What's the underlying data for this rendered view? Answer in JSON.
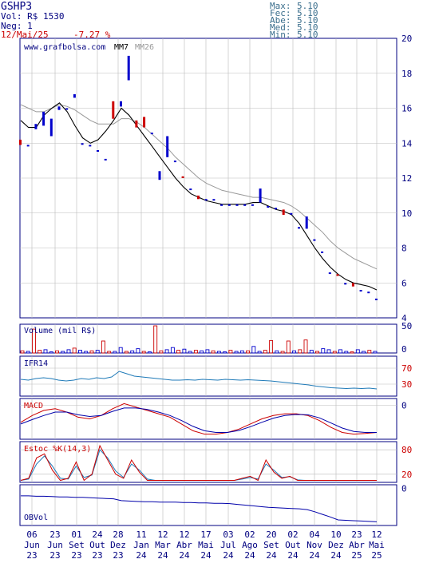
{
  "header": {
    "ticker": "GSHP3",
    "volume_line": "Vol: R$ 1530",
    "trades_line": "Neg: 1",
    "date": "12/Mai/25",
    "change": "-7.27 %",
    "stats": [
      {
        "label": "Max:",
        "value": "5.10"
      },
      {
        "label": "Fec:",
        "value": "5.10"
      },
      {
        "label": "Abe:",
        "value": "5.10"
      },
      {
        "label": "Med:",
        "value": "5.10"
      },
      {
        "label": "Min:",
        "value": "5.10"
      }
    ]
  },
  "colors": {
    "up": "#0000cc",
    "down": "#cc0000",
    "mm7": "#000000",
    "mm26": "#999999",
    "grid": "#bbbbbb",
    "axis": "#000080",
    "ifr": "#1f7ab8",
    "obv": "#0000aa"
  },
  "chart_data": [
    {
      "type": "candlestick",
      "source_label": "www.grafbolsa.com",
      "legend": [
        "MM7",
        "MM26"
      ],
      "ylim": [
        4,
        20
      ],
      "yticks": [
        "4",
        "6",
        "8",
        "10",
        "12",
        "14",
        "16",
        "18",
        "20"
      ],
      "x_ticks": [
        {
          "day": "06",
          "month": "Jun",
          "year": "23"
        },
        {
          "day": "23",
          "month": "Jun",
          "year": "23"
        },
        {
          "day": "01",
          "month": "Set",
          "year": "23"
        },
        {
          "day": "24",
          "month": "Out",
          "year": "23"
        },
        {
          "day": "28",
          "month": "Dez",
          "year": "23"
        },
        {
          "day": "11",
          "month": "Jan",
          "year": "24"
        },
        {
          "day": "12",
          "month": "Mar",
          "year": "24"
        },
        {
          "day": "12",
          "month": "Abr",
          "year": "24"
        },
        {
          "day": "17",
          "month": "Mai",
          "year": "24"
        },
        {
          "day": "03",
          "month": "Jul",
          "year": "24"
        },
        {
          "day": "02",
          "month": "Ago",
          "year": "24"
        },
        {
          "day": "20",
          "month": "Set",
          "year": "24"
        },
        {
          "day": "02",
          "month": "Out",
          "year": "24"
        },
        {
          "day": "04",
          "month": "Nov",
          "year": "24"
        },
        {
          "day": "10",
          "month": "Dez",
          "year": "24"
        },
        {
          "day": "23",
          "month": "Abr",
          "year": "25"
        },
        {
          "day": "12",
          "month": "Mai",
          "year": "25"
        }
      ],
      "candles": [
        {
          "o": 14.2,
          "c": 13.9
        },
        {
          "o": 13.9,
          "c": 13.9
        },
        {
          "o": 14.8,
          "c": 15.1
        },
        {
          "o": 15.0,
          "c": 15.8
        },
        {
          "o": 14.4,
          "c": 15.4
        },
        {
          "o": 15.9,
          "c": 16.1
        },
        {
          "o": 16.0,
          "c": 16.0
        },
        {
          "o": 16.6,
          "c": 16.8
        },
        {
          "o": 14.0,
          "c": 14.0
        },
        {
          "o": 13.9,
          "c": 13.9
        },
        {
          "o": 13.6,
          "c": 13.6
        },
        {
          "o": 13.1,
          "c": 13.1
        },
        {
          "o": 16.4,
          "c": 15.4
        },
        {
          "o": 16.1,
          "c": 16.4
        },
        {
          "o": 17.6,
          "c": 19.0
        },
        {
          "o": 15.3,
          "c": 14.9
        },
        {
          "o": 15.5,
          "c": 14.9
        },
        {
          "o": 14.6,
          "c": 14.6
        },
        {
          "o": 11.9,
          "c": 12.4
        },
        {
          "o": 13.2,
          "c": 14.4
        },
        {
          "o": 13.0,
          "c": 13.0
        },
        {
          "o": 12.1,
          "c": 12.0
        },
        {
          "o": 11.4,
          "c": 11.4
        },
        {
          "o": 11.0,
          "c": 10.8
        },
        {
          "o": 10.8,
          "c": 10.8
        },
        {
          "o": 10.8,
          "c": 10.8
        },
        {
          "o": 10.5,
          "c": 10.5
        },
        {
          "o": 10.5,
          "c": 10.5
        },
        {
          "o": 10.5,
          "c": 10.5
        },
        {
          "o": 10.5,
          "c": 10.5
        },
        {
          "o": 10.5,
          "c": 10.5
        },
        {
          "o": 10.6,
          "c": 11.4
        },
        {
          "o": 10.4,
          "c": 10.4
        },
        {
          "o": 10.3,
          "c": 10.3
        },
        {
          "o": 10.2,
          "c": 9.9
        },
        {
          "o": 10.0,
          "c": 10.0
        },
        {
          "o": 9.2,
          "c": 9.2
        },
        {
          "o": 9.1,
          "c": 9.8
        },
        {
          "o": 8.5,
          "c": 8.5
        },
        {
          "o": 7.8,
          "c": 7.8
        },
        {
          "o": 6.6,
          "c": 6.6
        },
        {
          "o": 6.5,
          "c": 6.4
        },
        {
          "o": 6.0,
          "c": 6.0
        },
        {
          "o": 6.0,
          "c": 5.8
        },
        {
          "o": 5.6,
          "c": 5.6
        },
        {
          "o": 5.5,
          "c": 5.5
        },
        {
          "o": 5.1,
          "c": 5.1
        }
      ],
      "mm7": [
        15.3,
        14.9,
        14.9,
        15.6,
        16.0,
        16.3,
        15.8,
        15.0,
        14.3,
        14.0,
        14.2,
        14.7,
        15.3,
        16.0,
        15.6,
        15.0,
        14.4,
        13.8,
        13.2,
        12.6,
        12.0,
        11.5,
        11.1,
        10.9,
        10.7,
        10.6,
        10.5,
        10.5,
        10.5,
        10.5,
        10.6,
        10.6,
        10.4,
        10.2,
        10.1,
        9.9,
        9.4,
        8.7,
        8.0,
        7.4,
        6.9,
        6.5,
        6.2,
        6.0,
        5.9,
        5.8,
        5.6
      ],
      "mm26": [
        16.2,
        16.0,
        15.8,
        15.8,
        16.0,
        16.2,
        16.1,
        15.9,
        15.6,
        15.3,
        15.1,
        15.1,
        15.1,
        15.4,
        15.4,
        15.2,
        14.9,
        14.5,
        14.1,
        13.7,
        13.2,
        12.8,
        12.4,
        12.0,
        11.7,
        11.5,
        11.3,
        11.2,
        11.1,
        11.0,
        10.9,
        10.9,
        10.8,
        10.7,
        10.6,
        10.4,
        10.1,
        9.7,
        9.3,
        8.9,
        8.4,
        8.0,
        7.7,
        7.4,
        7.2,
        7.0,
        6.8
      ]
    },
    {
      "type": "bar",
      "title": "Volume (mil R$)",
      "yticks": [
        "0",
        "50"
      ],
      "ylim": [
        0,
        50
      ],
      "values": [
        4,
        3,
        44,
        5,
        6,
        2,
        4,
        3,
        6,
        9,
        5,
        3,
        4,
        5,
        22,
        3,
        3,
        10,
        3,
        4,
        8,
        3,
        2,
        50,
        4,
        6,
        10,
        5,
        7,
        3,
        5,
        4,
        6,
        4,
        3,
        2,
        5,
        3,
        4,
        4,
        12,
        3,
        5,
        23,
        4,
        3,
        22,
        4,
        6,
        24,
        5,
        3,
        8,
        6,
        3,
        6,
        3,
        2,
        6,
        3,
        5,
        3
      ]
    },
    {
      "type": "line",
      "title": "IFR14",
      "yticks": [
        "30",
        "70"
      ],
      "ylim": [
        0,
        100
      ],
      "values": [
        42,
        40,
        44,
        46,
        44,
        40,
        38,
        40,
        44,
        42,
        46,
        44,
        48,
        62,
        56,
        50,
        48,
        46,
        44,
        42,
        40,
        40,
        41,
        40,
        42,
        41,
        40,
        42,
        41,
        40,
        41,
        40,
        39,
        38,
        36,
        34,
        32,
        30,
        28,
        25,
        23,
        21,
        20,
        19,
        20,
        19,
        20,
        18
      ]
    },
    {
      "type": "line",
      "title": "MACD",
      "yticks": [
        "0"
      ],
      "ylim": [
        -1.0,
        0.2
      ],
      "series": [
        {
          "values": [
            -0.5,
            -0.3,
            -0.15,
            -0.1,
            -0.2,
            -0.35,
            -0.4,
            -0.3,
            -0.1,
            0.05,
            -0.05,
            -0.15,
            -0.25,
            -0.35,
            -0.55,
            -0.75,
            -0.85,
            -0.85,
            -0.8,
            -0.7,
            -0.55,
            -0.4,
            -0.3,
            -0.25,
            -0.25,
            -0.3,
            -0.45,
            -0.65,
            -0.8,
            -0.85,
            -0.83,
            -0.8
          ]
        },
        {
          "values": [
            -0.55,
            -0.42,
            -0.3,
            -0.2,
            -0.2,
            -0.28,
            -0.33,
            -0.3,
            -0.18,
            -0.08,
            -0.08,
            -0.12,
            -0.2,
            -0.3,
            -0.45,
            -0.62,
            -0.75,
            -0.8,
            -0.8,
            -0.74,
            -0.63,
            -0.5,
            -0.38,
            -0.3,
            -0.27,
            -0.28,
            -0.37,
            -0.52,
            -0.67,
            -0.77,
            -0.8,
            -0.8
          ]
        }
      ]
    },
    {
      "type": "line",
      "title": "Estoc %K(14,3)",
      "yticks": [
        "20",
        "80"
      ],
      "ylim": [
        0,
        100
      ],
      "series": [
        {
          "values": [
            5,
            10,
            60,
            70,
            30,
            5,
            10,
            50,
            5,
            20,
            90,
            55,
            20,
            10,
            55,
            25,
            5,
            5,
            5,
            5,
            5,
            5,
            5,
            5,
            5,
            5,
            5,
            5,
            10,
            15,
            5,
            55,
            25,
            10,
            15,
            5,
            5,
            5,
            5,
            5,
            5,
            5,
            5,
            5,
            5,
            5
          ]
        },
        {
          "values": [
            5,
            8,
            45,
            65,
            40,
            10,
            8,
            40,
            12,
            18,
            80,
            60,
            28,
            12,
            45,
            30,
            8,
            5,
            5,
            5,
            5,
            5,
            5,
            5,
            5,
            5,
            5,
            5,
            8,
            12,
            8,
            45,
            30,
            12,
            14,
            6,
            5,
            5,
            5,
            5,
            5,
            5,
            5,
            5,
            5,
            5
          ]
        }
      ]
    },
    {
      "type": "line",
      "title": "OBVol",
      "yticks": [
        "0"
      ],
      "ylim": [
        -100,
        10
      ],
      "values": [
        -20,
        -20,
        -21,
        -21,
        -22,
        -23,
        -23,
        -24,
        -24,
        -25,
        -26,
        -27,
        -28,
        -33,
        -34,
        -35,
        -36,
        -36,
        -37,
        -37,
        -37,
        -38,
        -38,
        -39,
        -39,
        -40,
        -40,
        -41,
        -43,
        -45,
        -47,
        -49,
        -51,
        -52,
        -53,
        -54,
        -55,
        -57,
        -63,
        -70,
        -77,
        -85,
        -86,
        -87,
        -88,
        -89,
        -90
      ]
    }
  ]
}
